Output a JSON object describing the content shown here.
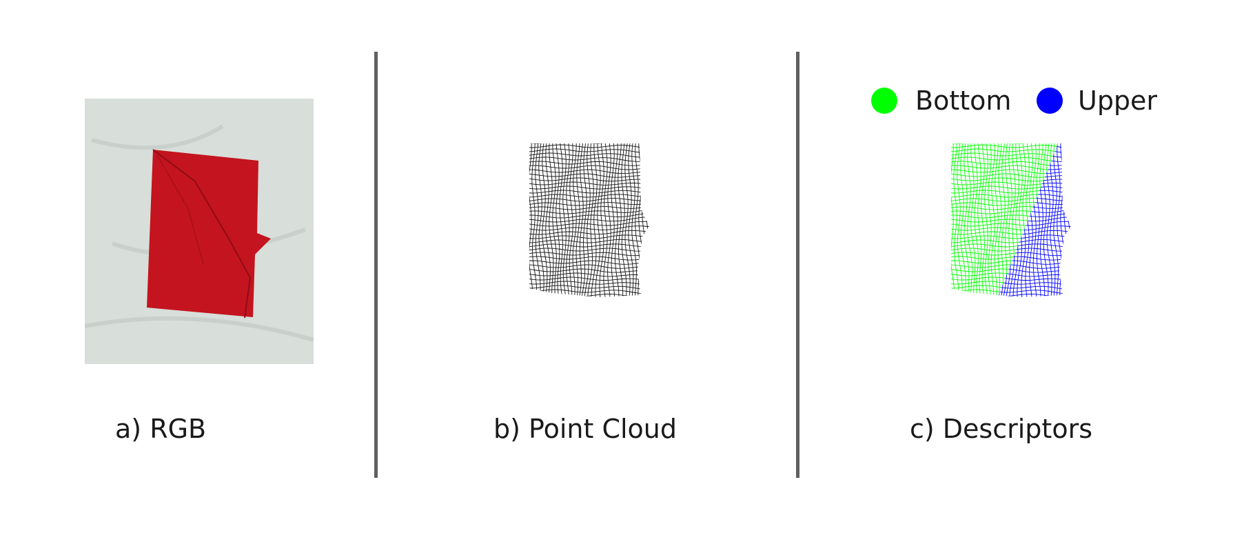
{
  "panels": [
    {
      "caption": "a) RGB"
    },
    {
      "caption": "b) Point Cloud"
    },
    {
      "caption": "c) Descriptors"
    }
  ],
  "legend": [
    {
      "label": "Bottom",
      "color": "#00ff00"
    },
    {
      "label": "Upper",
      "color": "#0000ff"
    }
  ],
  "colors": {
    "divider": "#5f5f5f",
    "photo_background": "#d9dfda",
    "cloth": "#c4141f",
    "point_cloud": "#111111",
    "bottom_layer": "#00ff00",
    "upper_layer": "#0000ff"
  }
}
